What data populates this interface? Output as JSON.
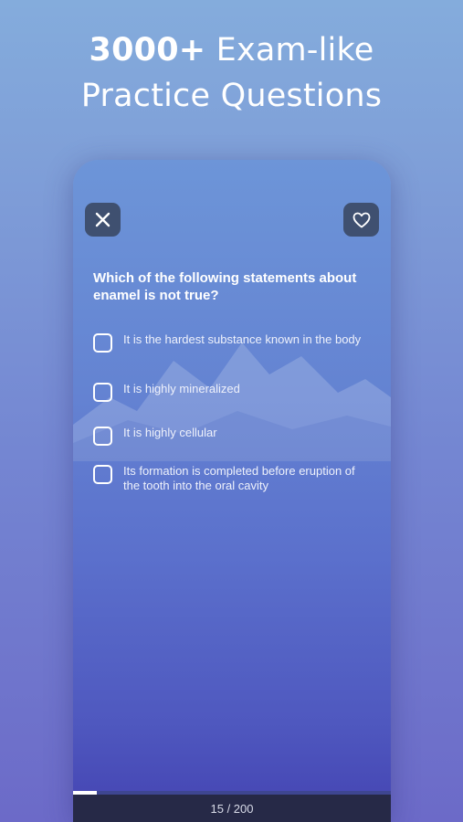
{
  "headline": {
    "bold": "3000+",
    "rest": "Exam-like",
    "line2": "Practice Questions"
  },
  "quiz": {
    "question": "Which of the following statements about enamel is not true?",
    "options": [
      "It is the hardest substance known in the body",
      "It is highly mineralized",
      "It is highly cellular",
      "Its formation is completed before eruption of the tooth into the oral cavity"
    ],
    "progress": {
      "current": 15,
      "total": 200,
      "label": "15 / 200",
      "fraction": 0.075
    }
  },
  "icons": {
    "close": "close-icon",
    "favorite": "heart-icon"
  },
  "colors": {
    "icon_button_bg": "#3f5070",
    "bottom_bar_bg": "#262947"
  }
}
